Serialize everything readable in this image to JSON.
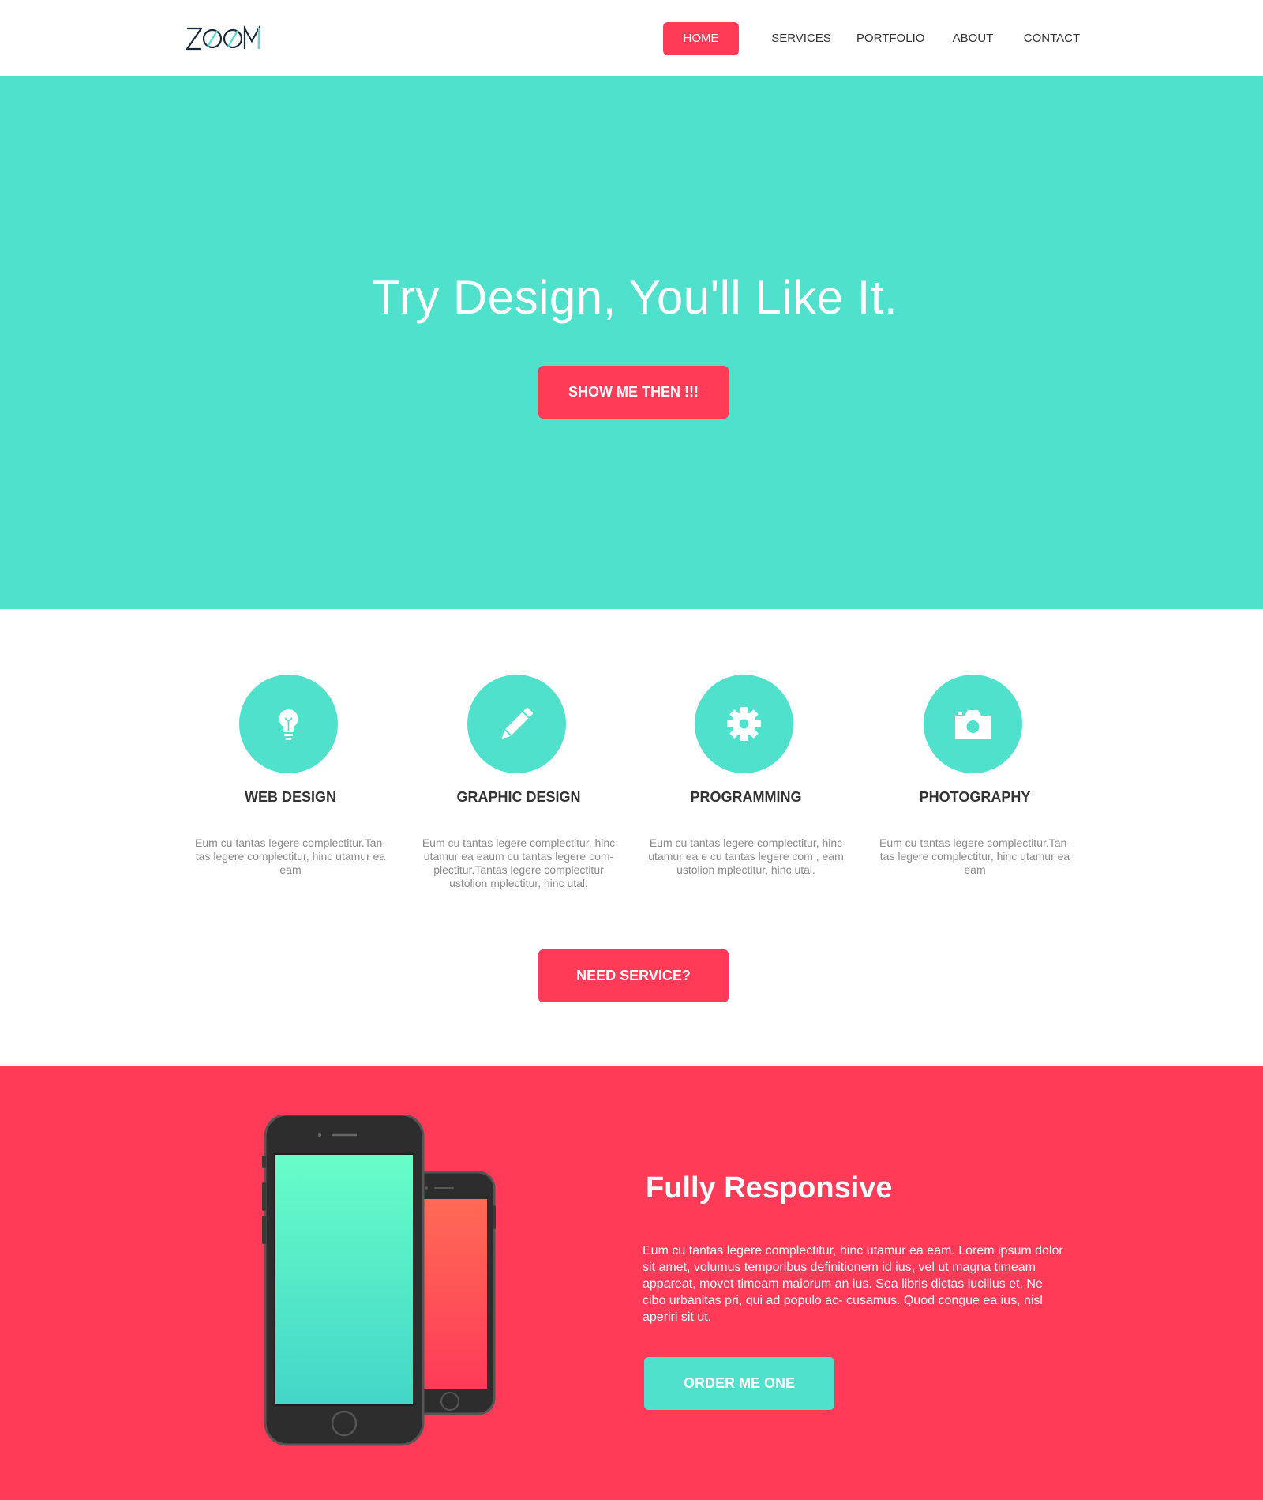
{
  "header": {
    "logo_text": "ZOOM",
    "nav": [
      {
        "label": "HOME"
      },
      {
        "label": "SERVICES"
      },
      {
        "label": "PORTFOLIO"
      },
      {
        "label": "ABOUT"
      },
      {
        "label": "CONTACT"
      }
    ],
    "active": "HOME"
  },
  "hero": {
    "title": "Try Design, You'll Like It.",
    "button": "SHOW ME THEN !!!"
  },
  "services": {
    "items": [
      {
        "icon": "lightbulb-icon",
        "title": "WEB DESIGN",
        "desc": "Eum cu tantas legere complectitur.Tan- tas legere complectitur, hinc utamur ea eam"
      },
      {
        "icon": "pencil-icon",
        "title": "GRAPHIC DESIGN",
        "desc": "Eum cu tantas legere complectitur, hinc utamur ea eaum cu tantas legere com- plectitur.Tantas legere complectitur ustolion mplectitur, hinc utal."
      },
      {
        "icon": "gear-icon",
        "title": "PROGRAMMING",
        "desc": "Eum cu tantas legere complectitur, hinc utamur ea e cu tantas legere com , eam ustolion mplectitur, hinc utal."
      },
      {
        "icon": "camera-icon",
        "title": "PHOTOGRAPHY",
        "desc": "Eum cu tantas legere complectitur.Tan- tas legere complectitur, hinc utamur ea eam"
      }
    ],
    "button": "NEED SERVICE?"
  },
  "responsive": {
    "title": "Fully Responsive",
    "text": "Eum cu tantas legere complectitur, hinc utamur ea eam. Lorem ipsum dolor sit amet, volumus temporibus definitionem id ius, vel ut magna timeam appareat, movet timeam maiorum an ius. Sea libris dictas lucilius et. Ne cibo urbanitas pri, qui ad populo ac- cusamus. Quod congue ea ius, nisl aperiri sit ut.",
    "button": "ORDER ME ONE"
  },
  "colors": {
    "accent_red": "#ff3b58",
    "accent_teal": "#4fe1cc",
    "text_dark": "#333333",
    "text_muted": "#8a8a8a"
  }
}
